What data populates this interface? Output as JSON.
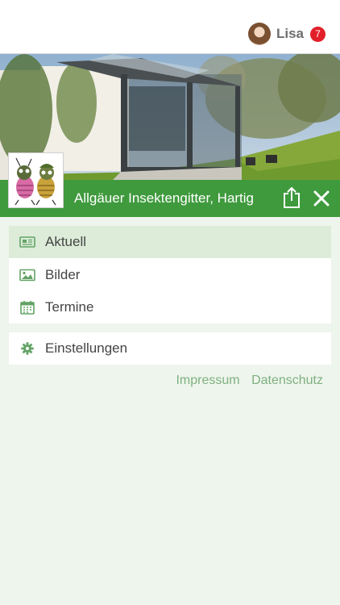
{
  "header": {
    "user_name": "Lisa",
    "notification_count": "7"
  },
  "store": {
    "title": "Allgäuer Insektengitter, Hartig"
  },
  "menu": {
    "items": [
      {
        "label": "Aktuell",
        "icon": "newspaper-icon",
        "active": true
      },
      {
        "label": "Bilder",
        "icon": "image-icon",
        "active": false
      },
      {
        "label": "Termine",
        "icon": "calendar-icon",
        "active": false
      }
    ]
  },
  "settings": {
    "label": "Einstellungen",
    "icon": "gear-icon"
  },
  "footer": {
    "impressum": "Impressum",
    "datenschutz": "Datenschutz"
  },
  "colors": {
    "brand_green": "#3f9a3d",
    "active_row": "#dcecd9",
    "background": "#eef5ec",
    "badge_red": "#e2202a",
    "link_green": "#7fb081"
  }
}
